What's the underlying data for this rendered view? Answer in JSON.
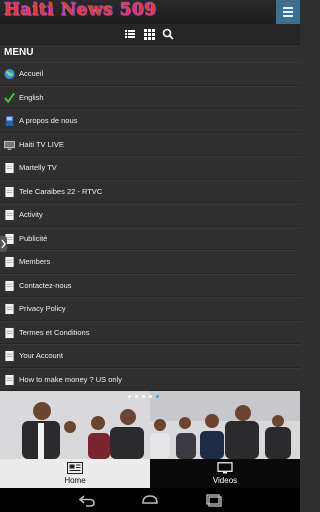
{
  "app": {
    "title": "Haiti News 509",
    "accent": "#3f6f8f"
  },
  "menu": {
    "title": "MENU",
    "items": [
      {
        "label": "Accueil",
        "icon": "globe-icon"
      },
      {
        "label": "English",
        "icon": "checkmark-icon"
      },
      {
        "label": "A propos de nous",
        "icon": "book-icon"
      },
      {
        "label": "Haiti TV LIVE",
        "icon": "tv-icon"
      },
      {
        "label": "Martelly TV",
        "icon": "document-icon"
      },
      {
        "label": "Tele Caraibes 22 - RTVC",
        "icon": "document-icon"
      },
      {
        "label": "Activity",
        "icon": "document-icon"
      },
      {
        "label": "Publicité",
        "icon": "document-icon"
      },
      {
        "label": "Members",
        "icon": "document-icon"
      },
      {
        "label": "Contactez-nous",
        "icon": "document-icon"
      },
      {
        "label": "Privacy Policy",
        "icon": "document-icon"
      },
      {
        "label": "Termes et Conditions",
        "icon": "document-icon"
      },
      {
        "label": "Your Account",
        "icon": "document-icon"
      },
      {
        "label": "How to make money ? US only",
        "icon": "document-icon"
      }
    ]
  },
  "toolbar": {
    "icons": [
      "list-view-icon",
      "grid-view-icon",
      "search-icon"
    ]
  },
  "banner": {
    "slide_count": 5,
    "active_slide": 5
  },
  "tabs": [
    {
      "label": "Home",
      "icon": "newspaper-icon",
      "active": true
    },
    {
      "label": "Videos",
      "icon": "monitor-icon",
      "active": false
    }
  ],
  "system_nav": {
    "icons": [
      "back-icon",
      "home-icon",
      "recent-apps-icon"
    ]
  }
}
